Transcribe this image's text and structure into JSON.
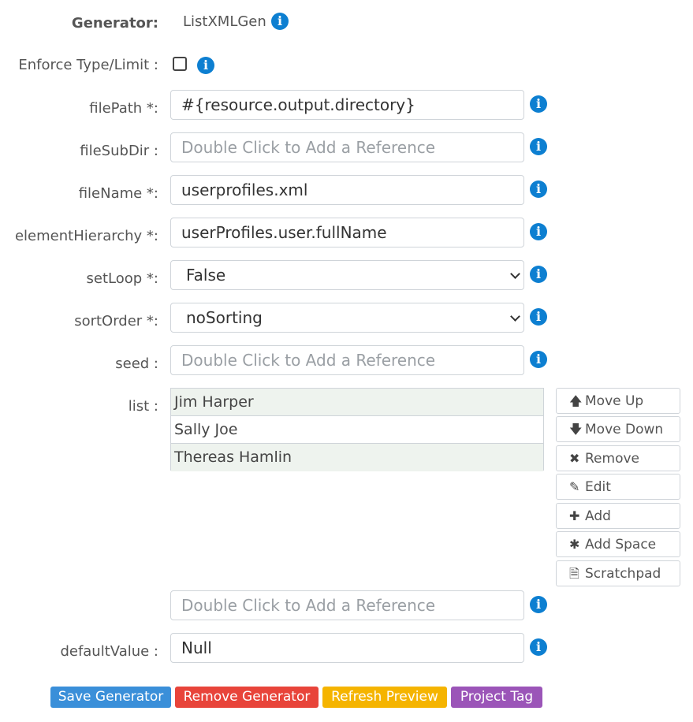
{
  "generator": {
    "label": "Generator:",
    "value": "ListXMLGen"
  },
  "enforce": {
    "label": "Enforce Type/Limit :",
    "checked": false
  },
  "fields": {
    "filePath": {
      "label": "filePath *:",
      "value": "#{resource.output.directory}"
    },
    "fileSubDir": {
      "label": "fileSubDir :",
      "placeholder": "Double Click to Add a Reference"
    },
    "fileName": {
      "label": "fileName *:",
      "value": "userprofiles.xml"
    },
    "elementHierarchy": {
      "label": "elementHierarchy *:",
      "value": "userProfiles.user.fullName"
    },
    "setLoop": {
      "label": "setLoop *:",
      "selected": "False"
    },
    "sortOrder": {
      "label": "sortOrder *:",
      "selected": "noSorting"
    },
    "seed": {
      "label": "seed :",
      "placeholder": "Double Click to Add a Reference"
    },
    "list": {
      "label": "list :",
      "items": [
        "Jim Harper",
        "Sally Joe",
        "Thereas Hamlin"
      ],
      "reference_placeholder": "Double Click to Add a Reference"
    },
    "defaultValue": {
      "label": "defaultValue :",
      "value": "Null"
    }
  },
  "list_buttons": {
    "move_up": "Move Up",
    "move_down": "Move Down",
    "remove": "Remove",
    "edit": "Edit",
    "add": "Add",
    "add_space": "Add Space",
    "scratchpad": "Scratchpad"
  },
  "icons": {
    "info": "info-circle-icon",
    "move_up": "arrow-up-icon",
    "move_down": "arrow-down-icon",
    "remove": "times-icon",
    "edit": "pencil-icon",
    "add": "plus-icon",
    "add_space": "asterisk-icon",
    "scratchpad": "file-icon",
    "select": "chevron-down-icon"
  },
  "actions": {
    "save": "Save Generator",
    "remove": "Remove Generator",
    "refresh": "Refresh Preview",
    "tag": "Project Tag"
  },
  "colors": {
    "info": "#0d7fd1",
    "save": "#3a8fd9",
    "remove": "#e8443a",
    "refresh": "#f5b400",
    "tag": "#9b55b8",
    "list_alt_row": "#eef3ee"
  }
}
